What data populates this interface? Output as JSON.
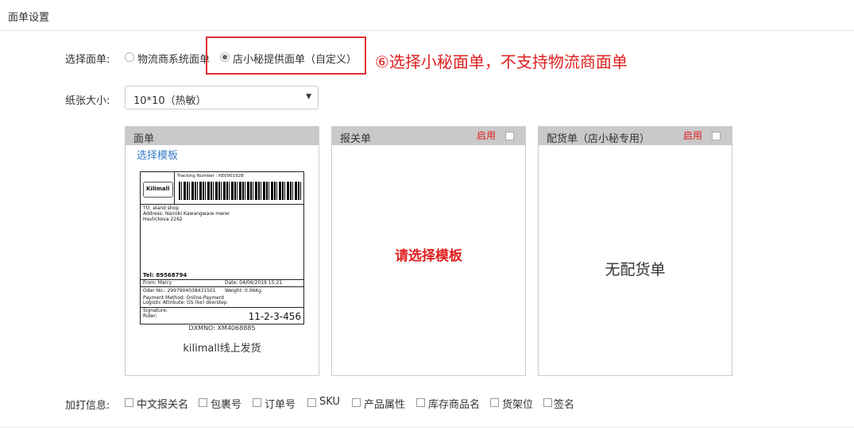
{
  "page": {
    "title": "面单设置"
  },
  "form": {
    "select_waybill_label": "选择面单:",
    "radio_options": [
      {
        "label": "物流商系统面单",
        "checked": false
      },
      {
        "label": "店小秘提供面单（自定义）",
        "checked": true
      }
    ],
    "annotation": "⑥选择小秘面单，不支持物流商面单",
    "paper_size_label": "纸张大小:",
    "paper_size_value": "10*10（热敏）"
  },
  "panels": [
    {
      "title": "面单",
      "select_template_link": "选择模板",
      "caption": "kilimall线上发货"
    },
    {
      "title": "报关单",
      "enable_label": "启用",
      "placeholder": "请选择模板"
    },
    {
      "title": "配货单（店小秘专用）",
      "enable_label": "启用",
      "empty_text": "无配货单"
    }
  ],
  "label_preview": {
    "brand": "Kilimall",
    "tracking": "Tracking Number : KE0001928",
    "to_line": "TO: eland shop",
    "address1": "Address: Nairobi Kawangware merer",
    "address2": "Havlickova 2262",
    "tel": "Tel: 89568794",
    "from": "From: Marry",
    "date": "Date: 04/06/2019 15:21",
    "order": "Oder No.: 29979040384315​01",
    "weight": "Weight: 0.06Kg",
    "payment": "Payment Method: Online Payment",
    "logistic": "Logistic Attribute: GS (ke)   doorstep",
    "signature": "Signature:",
    "rider": "Rider:",
    "route_code": "11-2-3-456",
    "dxm": "DXMNO: XM4068885"
  },
  "extra_print": {
    "label": "加打信息:",
    "options": [
      "中文报关名",
      "包裹号",
      "订单号",
      "SKU",
      "产品属性",
      "库存商品名",
      "货架位",
      "签名"
    ]
  },
  "colors": {
    "accent_red": "#e02020",
    "link_blue": "#3a7bc8",
    "panel_header": "#c9c9c9"
  }
}
